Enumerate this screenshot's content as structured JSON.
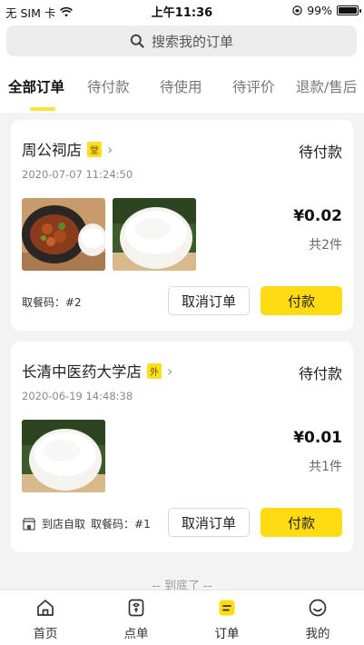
{
  "status_bar": {
    "carrier": "无 SIM 卡",
    "time": "上午11:36",
    "battery": "99%",
    "battery_level": 0.99
  },
  "search": {
    "placeholder": "搜索我的订单",
    "icon": "search-icon"
  },
  "tabs": [
    {
      "label": "全部订单",
      "active": true
    },
    {
      "label": "待付款",
      "active": false
    },
    {
      "label": "待使用",
      "active": false
    },
    {
      "label": "待评价",
      "active": false
    },
    {
      "label": "退款/售后",
      "active": false
    }
  ],
  "orders": [
    {
      "shop": "周公祠店",
      "tag": "堂",
      "status": "待付款",
      "time": "2020-07-07 11:24:50",
      "images": [
        "braised-pork-bowl",
        "rice-bowl"
      ],
      "price": "¥0.02",
      "count": "共2件",
      "pickup_mode": "",
      "pickup_code": "取餐码：#2",
      "cancel_label": "取消订单",
      "pay_label": "付款"
    },
    {
      "shop": "长清中医药大学店",
      "tag": "外",
      "status": "待付款",
      "time": "2020-06-19 14:48:38",
      "images": [
        "rice-bowl"
      ],
      "price": "¥0.01",
      "count": "共1件",
      "pickup_mode": "到店自取",
      "pickup_code": "取餐码：#1",
      "cancel_label": "取消订单",
      "pay_label": "付款"
    }
  ],
  "end_hint": "-- 到底了 --",
  "tabbar": [
    {
      "label": "首页",
      "icon": "home-icon",
      "active": false
    },
    {
      "label": "点单",
      "icon": "menu-icon",
      "active": false
    },
    {
      "label": "订单",
      "icon": "order-icon",
      "active": true
    },
    {
      "label": "我的",
      "icon": "profile-icon",
      "active": false
    }
  ],
  "colors": {
    "accent": "#ffdb11",
    "tag": "#ffdd1f"
  }
}
